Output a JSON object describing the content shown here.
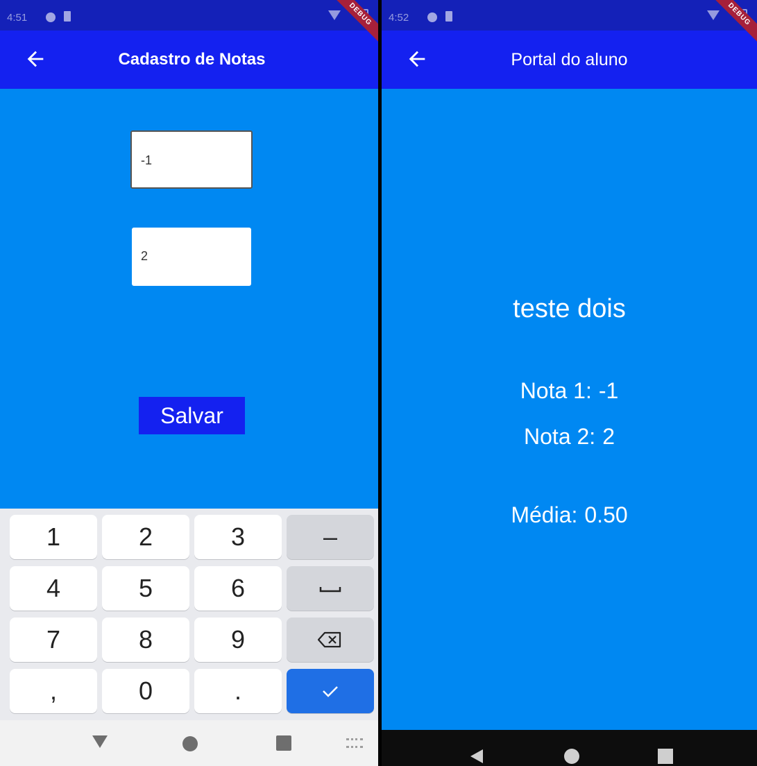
{
  "colors": {
    "background": "#0088F2",
    "app_bar": "#1421F0",
    "status_bar": "#1421B8",
    "debug_banner": "#A6203A",
    "keyboard_confirm": "#1F6FE5"
  },
  "left_screen": {
    "status_bar": {
      "time": "4:51"
    },
    "debug_banner": "DEBUG",
    "app_bar": {
      "back_icon": "arrow-left-icon",
      "title": "Cadastro de Notas"
    },
    "fields": {
      "nota1_value": "-1",
      "nota2_value": "2"
    },
    "save_button": "Salvar",
    "keyboard": {
      "rows": [
        [
          "1",
          "2",
          "3",
          "–"
        ],
        [
          "4",
          "5",
          "6",
          "space-icon"
        ],
        [
          "7",
          "8",
          "9",
          "backspace-icon"
        ],
        [
          ",",
          "0",
          ".",
          "check-icon"
        ]
      ],
      "key_1": "1",
      "key_2": "2",
      "key_3": "3",
      "key_minus": "–",
      "key_4": "4",
      "key_5": "5",
      "key_6": "6",
      "key_7": "7",
      "key_8": "8",
      "key_9": "9",
      "key_comma": ",",
      "key_0": "0",
      "key_period": "."
    }
  },
  "right_screen": {
    "status_bar": {
      "time": "4:52"
    },
    "debug_banner": "DEBUG",
    "app_bar": {
      "back_icon": "arrow-left-icon",
      "title": "Portal do aluno"
    },
    "student_name": "teste dois",
    "nota1": {
      "label": "Nota 1:",
      "value": "-1"
    },
    "nota2": {
      "label": "Nota 2:",
      "value": "2"
    },
    "media": {
      "label": "Média:",
      "value": "0.50"
    }
  }
}
